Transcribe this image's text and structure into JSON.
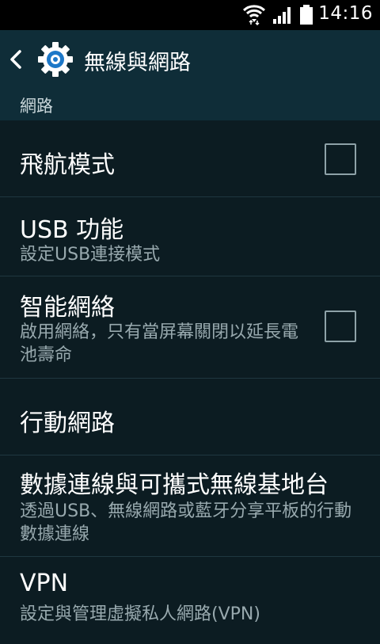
{
  "status": {
    "time": "14:16"
  },
  "header": {
    "title": "無線與網路"
  },
  "section": {
    "label": "網路"
  },
  "items": [
    {
      "title": "飛航模式",
      "summary": "",
      "checked": false
    },
    {
      "title": "USB 功能",
      "summary": "設定USB連接模式"
    },
    {
      "title": "智能網絡",
      "summary": "啟用網絡，只有當屏幕關閉以延長電池壽命",
      "checked": false
    },
    {
      "title": "行動網路",
      "summary": ""
    },
    {
      "title": "數據連線與可攜式無線基地台",
      "summary": "透過USB、無線網路或藍牙分享平板的行動數據連線"
    },
    {
      "title": "VPN",
      "summary": "設定與管理虛擬私人網路(VPN)"
    }
  ]
}
